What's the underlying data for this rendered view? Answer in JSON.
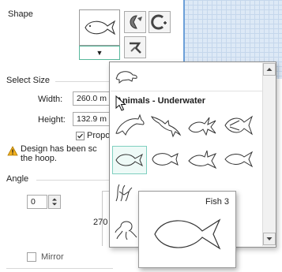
{
  "shape_section": {
    "label": "Shape",
    "buttons": [
      "fish-icon",
      "pac-shape-icon",
      "c-shape-icon",
      "cut-shape-icon"
    ],
    "dropdown_arrow": "▼"
  },
  "select_size": {
    "title": "Select Size",
    "width_label": "Width:",
    "width_value": "260.0 m",
    "height_label": "Height:",
    "height_value": "132.9 m",
    "proportional_label": "Propo",
    "proportional_checked": true
  },
  "warning": {
    "line1": "Design has been sc",
    "line2": "the hoop."
  },
  "angle": {
    "title": "Angle",
    "value": "0",
    "dial_label": "270"
  },
  "mirror": {
    "label": "Mirror",
    "checked": false
  },
  "shape_gallery": {
    "category": "Animals - Underwater",
    "top_item": "turtle-icon",
    "items": [
      "dolphin-icon",
      "dolphin-2-icon",
      "fish-1-icon",
      "fish-2-icon",
      "fish-3-icon",
      "fish-4-icon",
      "fish-5-icon",
      "fish-6-icon"
    ],
    "selected": "fish-3-icon"
  },
  "tooltip": {
    "title": "Fish 3"
  },
  "colors": {
    "accent": "#5b9bd5",
    "selected_border": "#7fcfc0"
  }
}
